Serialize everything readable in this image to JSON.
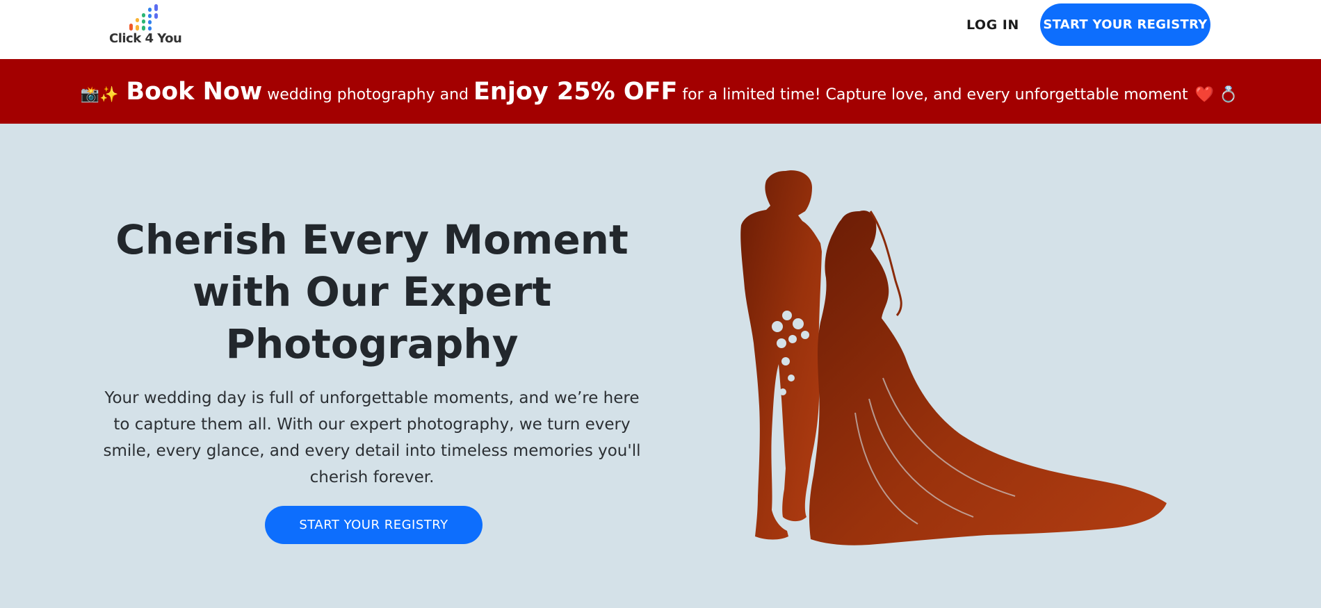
{
  "navbar": {
    "logo_text": "Click 4 You",
    "login_label": "LOG IN",
    "cta_label": "START YOUR REGISTRY"
  },
  "promo": {
    "emoji_start": "📸✨",
    "book_now": "Book Now",
    "text_1": "wedding photography and",
    "offer": "Enjoy 25% OFF",
    "text_2": "for a limited time! Capture love, and every unforgettable moment",
    "emoji_end": "❤️ 💍"
  },
  "hero": {
    "title": "Cherish Every Moment with Our Expert Photography",
    "description": "Your wedding day is full of unforgettable moments, and we’re here to capture them all. With our expert photography, we turn every smile, every glance, and every detail into timeless memories you'll cherish forever.",
    "cta_label": "START YOUR REGISTRY"
  },
  "colors": {
    "primary": "#0d6efd",
    "banner": "#a30000",
    "hero_bg": "#d4e1e8",
    "silhouette": "#8a2a08"
  }
}
